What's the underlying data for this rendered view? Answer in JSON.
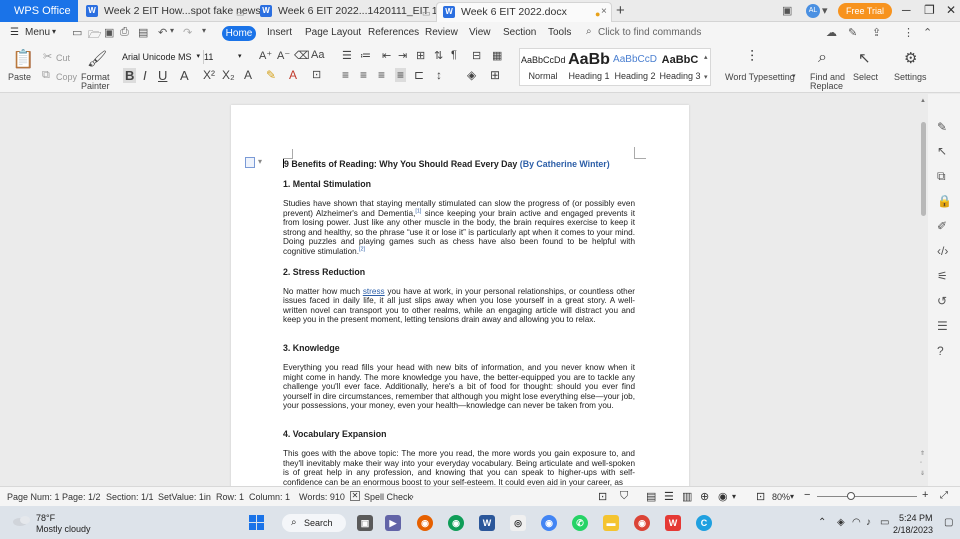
{
  "titlebar": {
    "app_name": "WPS Office",
    "tabs": [
      {
        "label": "Week 2 EIT How...spot fake news"
      },
      {
        "label": "Week 6 EIT 2022...1420111_EIT 103"
      },
      {
        "label": "Week 6 EIT 2022.docx"
      }
    ],
    "user_initials": "AL",
    "free_trial": "Free Trial"
  },
  "menubar": {
    "menu": "Menu",
    "items": [
      "Home",
      "Insert",
      "Page Layout",
      "References",
      "Review",
      "View",
      "Section",
      "Tools"
    ],
    "find_placeholder": "Click to find commands"
  },
  "ribbon": {
    "paste": "Paste",
    "cut": "Cut",
    "copy": "Copy",
    "format_painter_1": "Format",
    "format_painter_2": "Painter",
    "font_name": "Arial Unicode MS",
    "font_size": "11",
    "styles": [
      {
        "sample": "AaBbCcDd",
        "name": "Normal"
      },
      {
        "sample": "AaBb",
        "name": "Heading 1"
      },
      {
        "sample": "AaBbCcD",
        "name": "Heading 2"
      },
      {
        "sample": "AaBbC",
        "name": "Heading 3"
      }
    ],
    "word_typesetting": "Word Typesetting",
    "find_replace_1": "Find and",
    "find_replace_2": "Replace",
    "select": "Select",
    "settings": "Settings"
  },
  "document": {
    "title": "9 Benefits of Reading: Why You Should Read Every Day",
    "byline": "(By Catherine Winter)",
    "sections": [
      {
        "heading": "1. Mental Stimulation",
        "text_a": "Studies have shown that staying mentally stimulated can slow the progress of (or possibly even prevent) Alzheimer's and Dementia,",
        "ref_a": "[1]",
        "text_b": " since keeping your brain active and engaged prevents it from losing power. Just like any other muscle in the body, the brain requires exercise to keep it strong and healthy, so the phrase “use it or lose it” is particularly apt when it comes to your mind. Doing puzzles and playing games such as chess have also been found to be helpful with cognitive stimulation.",
        "ref_b": "[2]"
      },
      {
        "heading": "2. Stress Reduction",
        "text_a": "No matter how much ",
        "link": "stress",
        "text_b": " you have at work, in your personal relationships, or countless other issues faced in daily life, it all just slips away when you lose yourself in a great story. A well-written novel can transport you to other realms, while an engaging article will distract you and keep you in the present moment, letting tensions drain away and allowing you to relax."
      },
      {
        "heading": "3. Knowledge",
        "text": "Everything you read fills your head with new bits of information, and you never know when it might come in handy. The more knowledge you have, the better-equipped you are to tackle any challenge you'll ever face. Additionally, here's a bit of food for thought: should you ever find yourself in dire circumstances, remember that although you might lose everything else—your job, your possessions, your money, even your health—knowledge can never be taken from you."
      },
      {
        "heading": "4. Vocabulary Expansion",
        "text": "This goes with the above topic: The more you read, the more words you gain exposure to, and they'll inevitably make their way into your everyday vocabulary. Being articulate and well-spoken is of great help in any profession, and knowing that you can speak to higher-ups with self-confidence can be an enormous boost to your self-esteem. It could even aid in your career, as"
      }
    ]
  },
  "statusbar": {
    "page_num": "Page Num: 1",
    "page": "Page: 1/2",
    "section": "Section: 1/1",
    "setvalue": "SetValue: 1in",
    "row": "Row: 1",
    "column": "Column: 1",
    "words": "Words: 910",
    "spell_check": "Spell Check",
    "zoom": "80%",
    "zoom_level": 0.34
  },
  "taskbar": {
    "temperature": "78°F",
    "weather": "Mostly cloudy",
    "search": "Search",
    "time": "5:24 PM",
    "date": "2/18/2023"
  },
  "colors": {
    "accent": "#1a73e8",
    "free_trial": "#f7931e",
    "link": "#2d5fa8"
  }
}
